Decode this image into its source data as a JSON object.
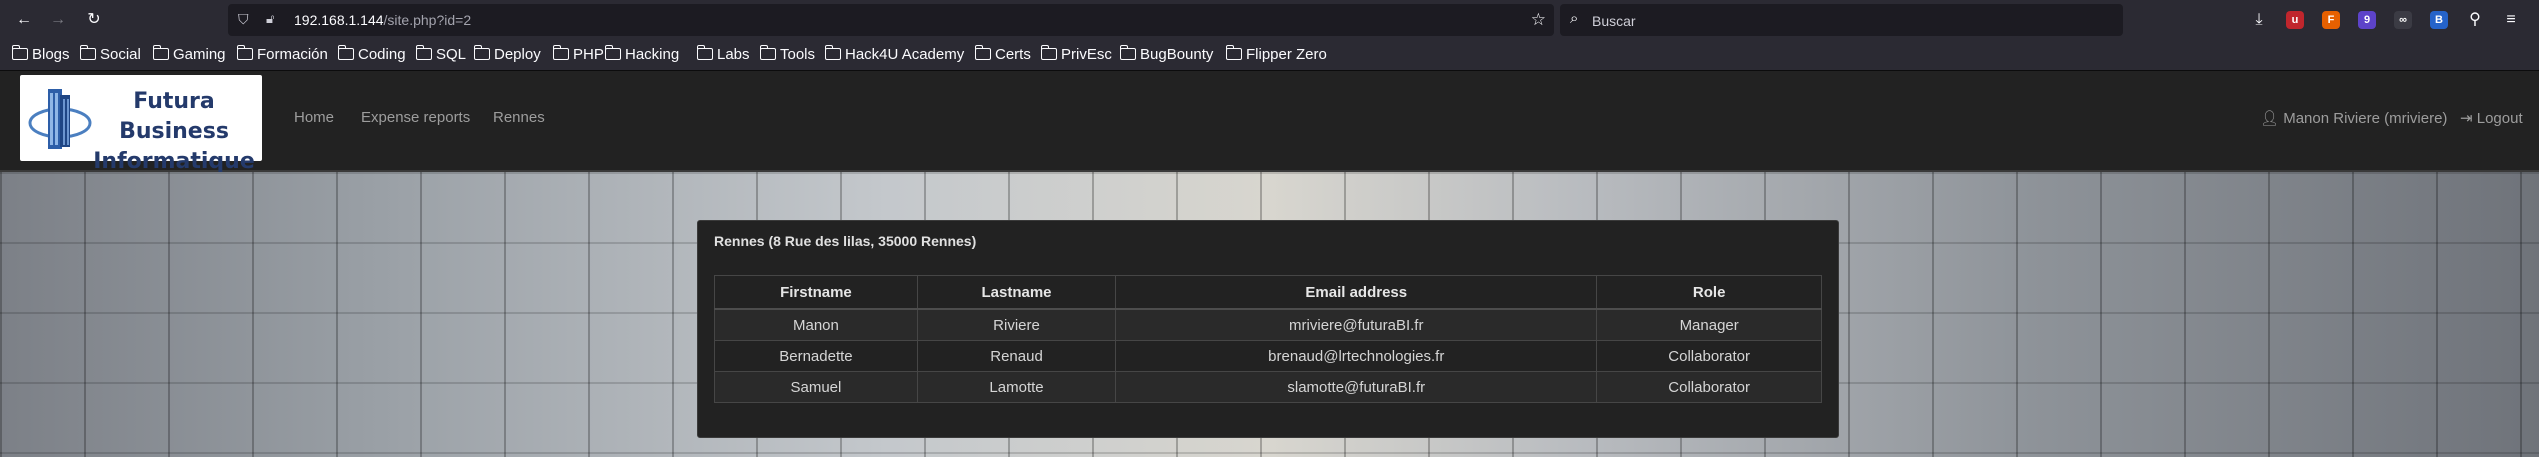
{
  "browser": {
    "url_host": "192.168.1.144",
    "url_path": "/site.php?id=2",
    "search_placeholder": "Buscar",
    "extensions": [
      {
        "name": "ublock-icon",
        "color": "#c0262d",
        "glyph": "u"
      },
      {
        "name": "fox-icon",
        "color": "#e66000",
        "glyph": "F"
      },
      {
        "name": "badge-icon",
        "color": "#5d43c9",
        "glyph": "9"
      },
      {
        "name": "glasses-icon",
        "color": "#3b3b44",
        "glyph": "∞"
      },
      {
        "name": "shield-ext-icon",
        "color": "#2563c9",
        "glyph": "B"
      }
    ]
  },
  "bookmarks": [
    "Blogs",
    "Social",
    "Gaming",
    "Formación",
    "Coding",
    "SQL",
    "Deploy",
    "PHP",
    "Hacking",
    "Labs",
    "Tools",
    "Hack4U Academy",
    "Certs",
    "PrivEsc",
    "BugBounty",
    "Flipper Zero"
  ],
  "site": {
    "brand_line1": "Futura Business",
    "brand_line2": "Informatique",
    "nav": {
      "home": "Home",
      "expense": "Expense reports",
      "rennes": "Rennes"
    },
    "user": "Manon Riviere (mriviere)",
    "logout": "Logout"
  },
  "panel": {
    "title": "Rennes (8 Rue des lilas, 35000 Rennes)",
    "columns": [
      "Firstname",
      "Lastname",
      "Email address",
      "Role"
    ],
    "rows": [
      [
        "Manon",
        "Riviere",
        "mriviere@futuraBI.fr",
        "Manager"
      ],
      [
        "Bernadette",
        "Renaud",
        "brenaud@lrtechnologies.fr",
        "Collaborator"
      ],
      [
        "Samuel",
        "Lamotte",
        "slamotte@futuraBI.fr",
        "Collaborator"
      ]
    ]
  }
}
